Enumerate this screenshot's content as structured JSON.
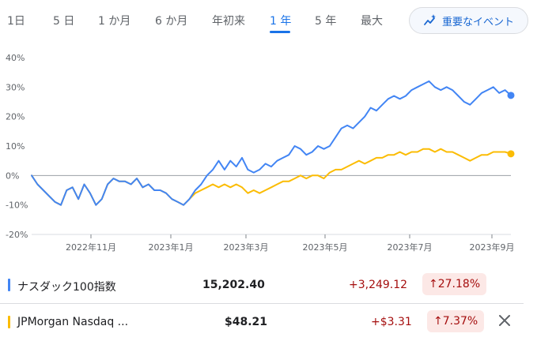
{
  "tabs": [
    {
      "label": "1日",
      "active": false
    },
    {
      "label": "5 日",
      "active": false
    },
    {
      "label": "1 か月",
      "active": false
    },
    {
      "label": "6 か月",
      "active": false
    },
    {
      "label": "年初来",
      "active": false
    },
    {
      "label": "1 年",
      "active": true
    },
    {
      "label": "5 年",
      "active": false
    },
    {
      "label": "最大",
      "active": false
    }
  ],
  "events_button": {
    "label": "重要なイベント",
    "icon": "sparkle-chart-icon"
  },
  "colors": {
    "accent": "#1a73e8",
    "series_blue": "#4285f4",
    "series_yellow": "#fbbc04",
    "negative": "#a50e0e",
    "negative_bg": "#fce8e6"
  },
  "chart_data": {
    "type": "line",
    "y_ticks": [
      "40%",
      "30%",
      "20%",
      "10%",
      "0%",
      "-10%",
      "-20%"
    ],
    "ylim": [
      -20,
      40
    ],
    "x_ticks": [
      "2022年11月",
      "2023年1月",
      "2023年3月",
      "2023年5月",
      "2023年7月",
      "2023年9月"
    ],
    "grid": false,
    "series": [
      {
        "name": "ナスダック100指数",
        "color": "#4285f4",
        "points": [
          [
            0,
            0
          ],
          [
            1,
            -3
          ],
          [
            2,
            -5
          ],
          [
            3,
            -7
          ],
          [
            4,
            -9
          ],
          [
            5,
            -10
          ],
          [
            6,
            -5
          ],
          [
            7,
            -4
          ],
          [
            8,
            -8
          ],
          [
            9,
            -3
          ],
          [
            10,
            -6
          ],
          [
            11,
            -10
          ],
          [
            12,
            -8
          ],
          [
            13,
            -3
          ],
          [
            14,
            -1
          ],
          [
            15,
            -2
          ],
          [
            16,
            -2
          ],
          [
            17,
            -3
          ],
          [
            18,
            -1
          ],
          [
            19,
            -4
          ],
          [
            20,
            -3
          ],
          [
            21,
            -5
          ],
          [
            22,
            -5
          ],
          [
            23,
            -6
          ],
          [
            24,
            -8
          ],
          [
            25,
            -9
          ],
          [
            26,
            -10
          ],
          [
            27,
            -8
          ],
          [
            28,
            -5
          ],
          [
            29,
            -3
          ],
          [
            30,
            0
          ],
          [
            31,
            2
          ],
          [
            32,
            5
          ],
          [
            33,
            2
          ],
          [
            34,
            5
          ],
          [
            35,
            3
          ],
          [
            36,
            6
          ],
          [
            37,
            2
          ],
          [
            38,
            1
          ],
          [
            39,
            2
          ],
          [
            40,
            4
          ],
          [
            41,
            3
          ],
          [
            42,
            5
          ],
          [
            43,
            6
          ],
          [
            44,
            7
          ],
          [
            45,
            10
          ],
          [
            46,
            9
          ],
          [
            47,
            7
          ],
          [
            48,
            8
          ],
          [
            49,
            10
          ],
          [
            50,
            9
          ],
          [
            51,
            10
          ],
          [
            52,
            13
          ],
          [
            53,
            16
          ],
          [
            54,
            17
          ],
          [
            55,
            16
          ],
          [
            56,
            18
          ],
          [
            57,
            20
          ],
          [
            58,
            23
          ],
          [
            59,
            22
          ],
          [
            60,
            24
          ],
          [
            61,
            26
          ],
          [
            62,
            27
          ],
          [
            63,
            26
          ],
          [
            64,
            27
          ],
          [
            65,
            29
          ],
          [
            66,
            30
          ],
          [
            67,
            31
          ],
          [
            68,
            32
          ],
          [
            69,
            30
          ],
          [
            70,
            29
          ],
          [
            71,
            30
          ],
          [
            72,
            29
          ],
          [
            73,
            27
          ],
          [
            74,
            25
          ],
          [
            75,
            24
          ],
          [
            76,
            26
          ],
          [
            77,
            28
          ],
          [
            78,
            29
          ],
          [
            79,
            30
          ],
          [
            80,
            28
          ],
          [
            81,
            29
          ],
          [
            82,
            27.18
          ]
        ]
      },
      {
        "name": "JPMorgan Nasdaq ...",
        "color": "#fbbc04",
        "points": [
          [
            0,
            0
          ],
          [
            1,
            -3
          ],
          [
            2,
            -5
          ],
          [
            3,
            -7
          ],
          [
            4,
            -9
          ],
          [
            5,
            -10
          ],
          [
            6,
            -5
          ],
          [
            7,
            -4
          ],
          [
            8,
            -8
          ],
          [
            9,
            -3
          ],
          [
            10,
            -6
          ],
          [
            11,
            -10
          ],
          [
            12,
            -8
          ],
          [
            13,
            -3
          ],
          [
            14,
            -1
          ],
          [
            15,
            -2
          ],
          [
            16,
            -2
          ],
          [
            17,
            -3
          ],
          [
            18,
            -1
          ],
          [
            19,
            -4
          ],
          [
            20,
            -3
          ],
          [
            21,
            -5
          ],
          [
            22,
            -5
          ],
          [
            23,
            -6
          ],
          [
            24,
            -8
          ],
          [
            25,
            -9
          ],
          [
            26,
            -10
          ],
          [
            27,
            -8
          ],
          [
            28,
            -6
          ],
          [
            29,
            -5
          ],
          [
            30,
            -4
          ],
          [
            31,
            -3
          ],
          [
            32,
            -4
          ],
          [
            33,
            -3
          ],
          [
            34,
            -4
          ],
          [
            35,
            -3
          ],
          [
            36,
            -4
          ],
          [
            37,
            -6
          ],
          [
            38,
            -5
          ],
          [
            39,
            -6
          ],
          [
            40,
            -5
          ],
          [
            41,
            -4
          ],
          [
            42,
            -3
          ],
          [
            43,
            -2
          ],
          [
            44,
            -2
          ],
          [
            45,
            -1
          ],
          [
            46,
            0
          ],
          [
            47,
            -1
          ],
          [
            48,
            0
          ],
          [
            49,
            0
          ],
          [
            50,
            -1
          ],
          [
            51,
            1
          ],
          [
            52,
            2
          ],
          [
            53,
            2
          ],
          [
            54,
            3
          ],
          [
            55,
            4
          ],
          [
            56,
            5
          ],
          [
            57,
            4
          ],
          [
            58,
            5
          ],
          [
            59,
            6
          ],
          [
            60,
            6
          ],
          [
            61,
            7
          ],
          [
            62,
            7
          ],
          [
            63,
            8
          ],
          [
            64,
            7
          ],
          [
            65,
            8
          ],
          [
            66,
            8
          ],
          [
            67,
            9
          ],
          [
            68,
            9
          ],
          [
            69,
            8
          ],
          [
            70,
            9
          ],
          [
            71,
            8
          ],
          [
            72,
            8
          ],
          [
            73,
            7
          ],
          [
            74,
            6
          ],
          [
            75,
            5
          ],
          [
            76,
            6
          ],
          [
            77,
            7
          ],
          [
            78,
            7
          ],
          [
            79,
            8
          ],
          [
            80,
            8
          ],
          [
            81,
            8
          ],
          [
            82,
            7.37
          ]
        ]
      }
    ]
  },
  "legend": [
    {
      "name": "ナスダック100指数",
      "price": "15,202.40",
      "change": "+3,249.12",
      "pct": "27.18%",
      "arrow": "↑"
    },
    {
      "name": "JPMorgan Nasdaq ...",
      "price": "$48.21",
      "change": "+$3.31",
      "pct": "7.37%",
      "arrow": "↑"
    }
  ]
}
